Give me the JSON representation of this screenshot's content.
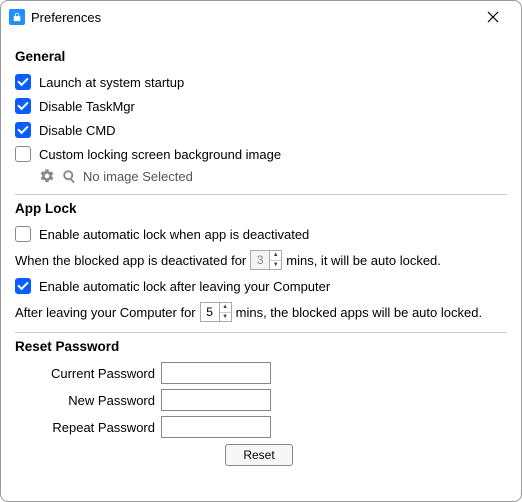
{
  "window": {
    "title": "Preferences"
  },
  "general": {
    "heading": "General",
    "launch": "Launch at system startup",
    "disable_taskmgr": "Disable TaskMgr",
    "disable_cmd": "Disable CMD",
    "custom_bg": "Custom locking screen background image",
    "no_image": "No image Selected",
    "checked": {
      "launch": true,
      "disable_taskmgr": true,
      "disable_cmd": true,
      "custom_bg": false
    }
  },
  "applock": {
    "heading": "App Lock",
    "auto_deactivate": "Enable automatic lock when app is deactivated",
    "deactivate_prefix": "When the blocked app is deactivated for",
    "deactivate_value": "3",
    "deactivate_suffix": "mins, it will be auto locked.",
    "auto_leave": "Enable automatic lock after leaving your Computer",
    "leave_prefix": "After leaving your Computer for",
    "leave_value": "5",
    "leave_suffix": "mins, the blocked apps will be auto locked.",
    "checked": {
      "auto_deactivate": false,
      "auto_leave": true
    }
  },
  "reset": {
    "heading": "Reset Password",
    "current": "Current Password",
    "new": "New Password",
    "repeat": "Repeat Password",
    "button": "Reset"
  }
}
